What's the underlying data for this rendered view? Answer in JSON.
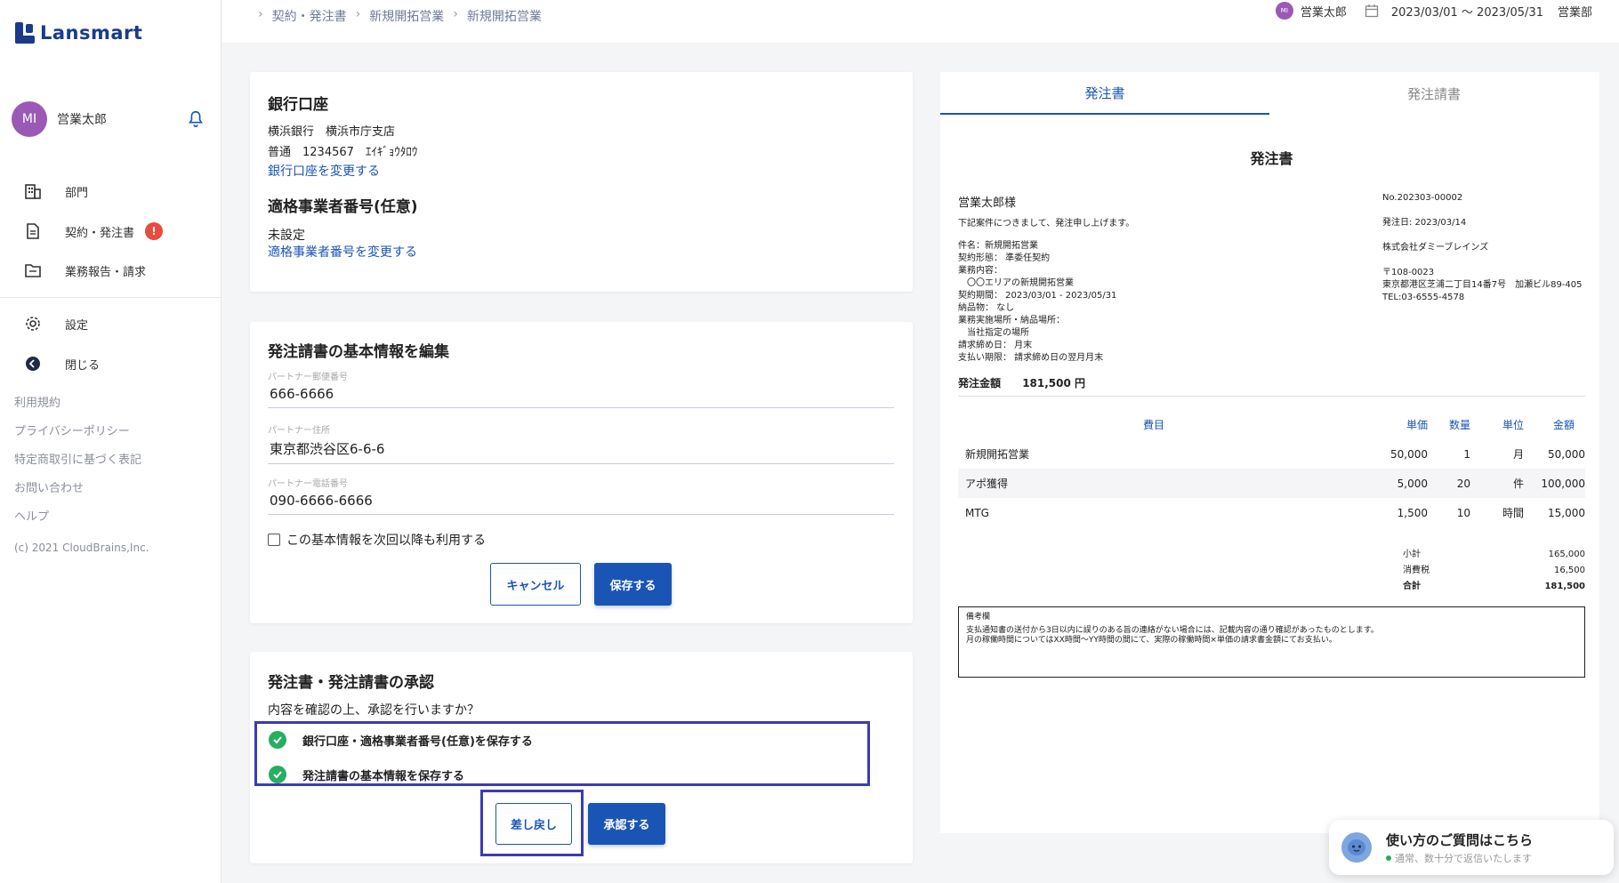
{
  "app": {
    "logo": "Lansmart"
  },
  "user": {
    "initials": "MI",
    "name": "営業太郎"
  },
  "nav": {
    "items": [
      {
        "label": "部門",
        "icon": "building-icon"
      },
      {
        "label": "契約・発注書",
        "icon": "document-icon",
        "badge": "!"
      },
      {
        "label": "業務報告・請求",
        "icon": "folder-icon"
      },
      {
        "label": "設定",
        "icon": "gear-icon"
      },
      {
        "label": "閉じる",
        "icon": "arrow-left-circle-icon"
      }
    ],
    "footer": [
      "利用規約",
      "プライバシーポリシー",
      "特定商取引に基づく表記",
      "お問い合わせ",
      "ヘルプ"
    ],
    "copyright": "(c) 2021 CloudBrains,Inc."
  },
  "header": {
    "breadcrumb": [
      "契約・発注書",
      "新規開拓営業",
      "新規開拓営業"
    ],
    "user_name": "営業太郎",
    "period": "2023/03/01 ～ 2023/05/31",
    "dept": "営業部"
  },
  "bank": {
    "title": "銀行口座",
    "line1": "横浜銀行　横浜市庁支店",
    "line2": "普通　1234567　ｴｲｷﾞｮｳﾀﾛｳ",
    "change_link": "銀行口座を変更する",
    "invoice_title": "適格事業者番号(任意)",
    "invoice_value": "未設定",
    "invoice_link": "適格事業者番号を変更する"
  },
  "basic": {
    "title": "発注請書の基本情報を編集",
    "fields": [
      {
        "label": "パートナー郵便番号",
        "value": "666-6666"
      },
      {
        "label": "パートナー住所",
        "value": "東京都渋谷区6-6-6"
      },
      {
        "label": "パートナー電話番号",
        "value": "090-6666-6666"
      }
    ],
    "checkbox_label": "この基本情報を次回以降も利用する",
    "cancel": "キャンセル",
    "save": "保存する"
  },
  "approval": {
    "title": "発注書・発注請書の承認",
    "question": "内容を確認の上、承認を行いますか？",
    "checks": [
      "銀行口座・適格事業者番号(任意)を保存する",
      "発注請書の基本情報を保存する"
    ],
    "reject": "差し戻し",
    "approve": "承認する"
  },
  "preview": {
    "tabs": [
      "発注書",
      "発注請書"
    ],
    "doc_title": "発注書",
    "to": "営業太郎様",
    "intro": "下記案件につきまして、発注申し上げます。",
    "details": [
      "件名：新規開拓営業",
      "契約形態： 準委任契約",
      "業務内容：",
      "　〇〇エリアの新規開拓営業",
      "契約期間： 2023/03/01 - 2023/05/31",
      "納品物： なし",
      "業務実施場所・納品場所：",
      "　当社指定の場所",
      "請求締め日： 月末",
      "支払い期限： 請求締め日の翌月月末"
    ],
    "amount_label": "発注金額",
    "amount": "181,500 円",
    "doc_no": "No.202303-00002",
    "issue_date": "発注日: 2023/03/14",
    "company": "株式会社ダミーブレインズ",
    "zip": "〒108-0023",
    "address": "東京都港区芝浦二丁目14番7号　加瀬ビル89-405",
    "tel": "TEL:03-6555-4578",
    "table_headers": [
      "費目",
      "単価",
      "数量",
      "単位",
      "金額"
    ],
    "rows": [
      {
        "item": "新規開拓営業",
        "price": "50,000",
        "qty": "1",
        "unit": "月",
        "amount": "50,000"
      },
      {
        "item": "アポ獲得",
        "price": "5,000",
        "qty": "20",
        "unit": "件",
        "amount": "100,000"
      },
      {
        "item": "MTG",
        "price": "1,500",
        "qty": "10",
        "unit": "時間",
        "amount": "15,000"
      }
    ],
    "subtotal_label": "小計",
    "subtotal": "165,000",
    "tax_label": "消費税",
    "tax": "16,500",
    "total_label": "合計",
    "total": "181,500",
    "notes_title": "備考欄",
    "notes_line1": "支払通知書の送付から3日以内に誤りのある旨の連絡がない場合には、記載内容の通り確認があったものとします。",
    "notes_line2": "月の稼働時間についてはXX時間〜YY時間の間にて、実際の稼働時間×単価の請求書金額にてお支払い。"
  },
  "chat": {
    "title": "使い方のご質問はこちら",
    "sub": "通常、数十分で返信いたします"
  },
  "colors": {
    "accent": "#1a55b5",
    "brand": "#1a3a8c",
    "highlight": "#3b3bb5",
    "success": "#27ae60",
    "alert": "#e74c3c"
  }
}
